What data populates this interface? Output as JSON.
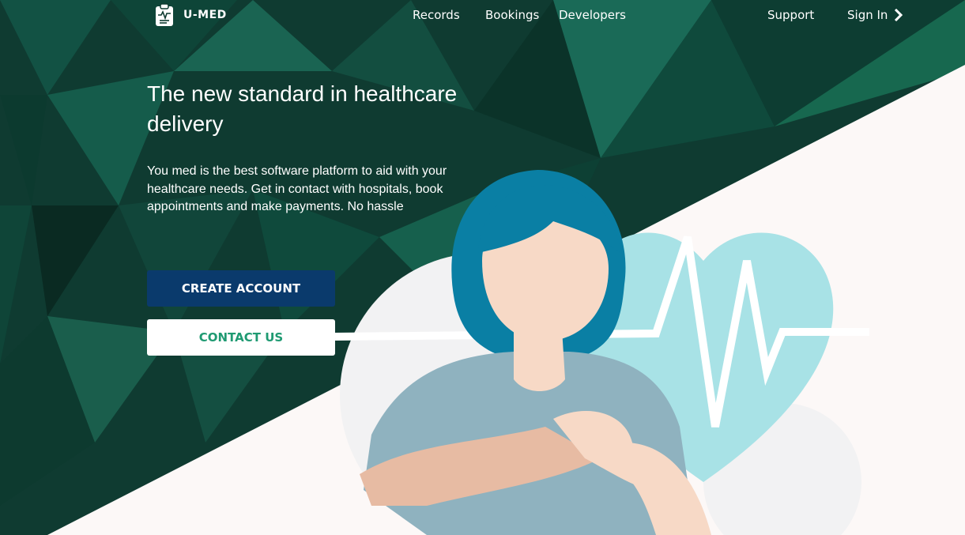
{
  "brand": {
    "name": "U-MED",
    "logo_icon": "clipboard-pulse-icon"
  },
  "nav": {
    "links": [
      {
        "label": "Records"
      },
      {
        "label": "Bookings"
      },
      {
        "label": "Developers"
      },
      {
        "label": "Support"
      }
    ],
    "signin": {
      "label": "Sign In",
      "icon": "chevron-right-icon"
    }
  },
  "hero": {
    "title": "The new standard in healthcare delivery",
    "description": "You med is the best software platform to aid with your healthcare needs. Get in contact with hospitals, book appointments and make payments. No hassle",
    "primary_button": "CREATE ACCOUNT",
    "secondary_button": "CONTACT US"
  },
  "colors": {
    "background": "#0f3b31",
    "panel": "#fcf8f7",
    "primary_button": "#0a3a6c",
    "secondary_text": "#1f9a72",
    "heart": "#a8e2e6",
    "hair": "#0a7fa4",
    "shirt": "#8fb2bf",
    "skin": "#f7d9c6"
  }
}
